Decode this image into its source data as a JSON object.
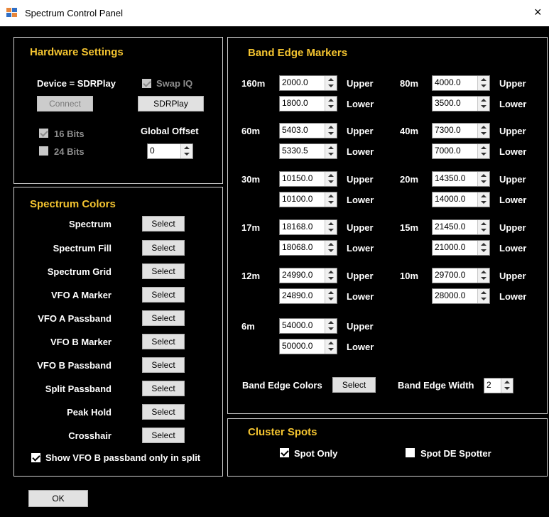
{
  "window": {
    "title": "Spectrum Control Panel",
    "close": "×"
  },
  "hardware": {
    "title": "Hardware Settings",
    "device_label": "Device = SDRPlay",
    "swap_iq": {
      "label": "Swap IQ",
      "checked": true,
      "enabled": false
    },
    "connect_button": "Connect",
    "sdrplay_button": "SDRPlay",
    "bits16": {
      "label": "16 Bits",
      "checked": true,
      "enabled": false
    },
    "bits24": {
      "label": "24 Bits",
      "checked": false,
      "enabled": false
    },
    "global_offset": {
      "label": "Global Offset",
      "value": "0"
    }
  },
  "spectrum_colors": {
    "title": "Spectrum Colors",
    "select_label": "Select",
    "items": [
      "Spectrum",
      "Spectrum Fill",
      "Spectrum Grid",
      "VFO A Marker",
      "VFO A Passband",
      "VFO B Marker",
      "VFO B Passband",
      "Split Passband",
      "Peak Hold",
      "Crosshair"
    ],
    "show_vfo_b": {
      "label": "Show VFO B passband only in split",
      "checked": true
    }
  },
  "band_edges": {
    "title": "Band Edge Markers",
    "upper_label": "Upper",
    "lower_label": "Lower",
    "bands": [
      {
        "band": "160m",
        "upper": "2000.0",
        "lower": "1800.0"
      },
      {
        "band": "80m",
        "upper": "4000.0",
        "lower": "3500.0"
      },
      {
        "band": "60m",
        "upper": "5403.0",
        "lower": "5330.5"
      },
      {
        "band": "40m",
        "upper": "7300.0",
        "lower": "7000.0"
      },
      {
        "band": "30m",
        "upper": "10150.0",
        "lower": "10100.0"
      },
      {
        "band": "20m",
        "upper": "14350.0",
        "lower": "14000.0"
      },
      {
        "band": "17m",
        "upper": "18168.0",
        "lower": "18068.0"
      },
      {
        "band": "15m",
        "upper": "21450.0",
        "lower": "21000.0"
      },
      {
        "band": "12m",
        "upper": "24990.0",
        "lower": "24890.0"
      },
      {
        "band": "10m",
        "upper": "29700.0",
        "lower": "28000.0"
      },
      {
        "band": "6m",
        "upper": "54000.0",
        "lower": "50000.0"
      }
    ],
    "colors_label": "Band Edge Colors",
    "colors_button": "Select",
    "width_label": "Band Edge Width",
    "width_value": "2"
  },
  "cluster_spots": {
    "title": "Cluster Spots",
    "spot_only": {
      "label": "Spot Only",
      "checked": true
    },
    "spot_de": {
      "label": "Spot DE Spotter",
      "checked": false
    }
  },
  "ok_button": "OK"
}
